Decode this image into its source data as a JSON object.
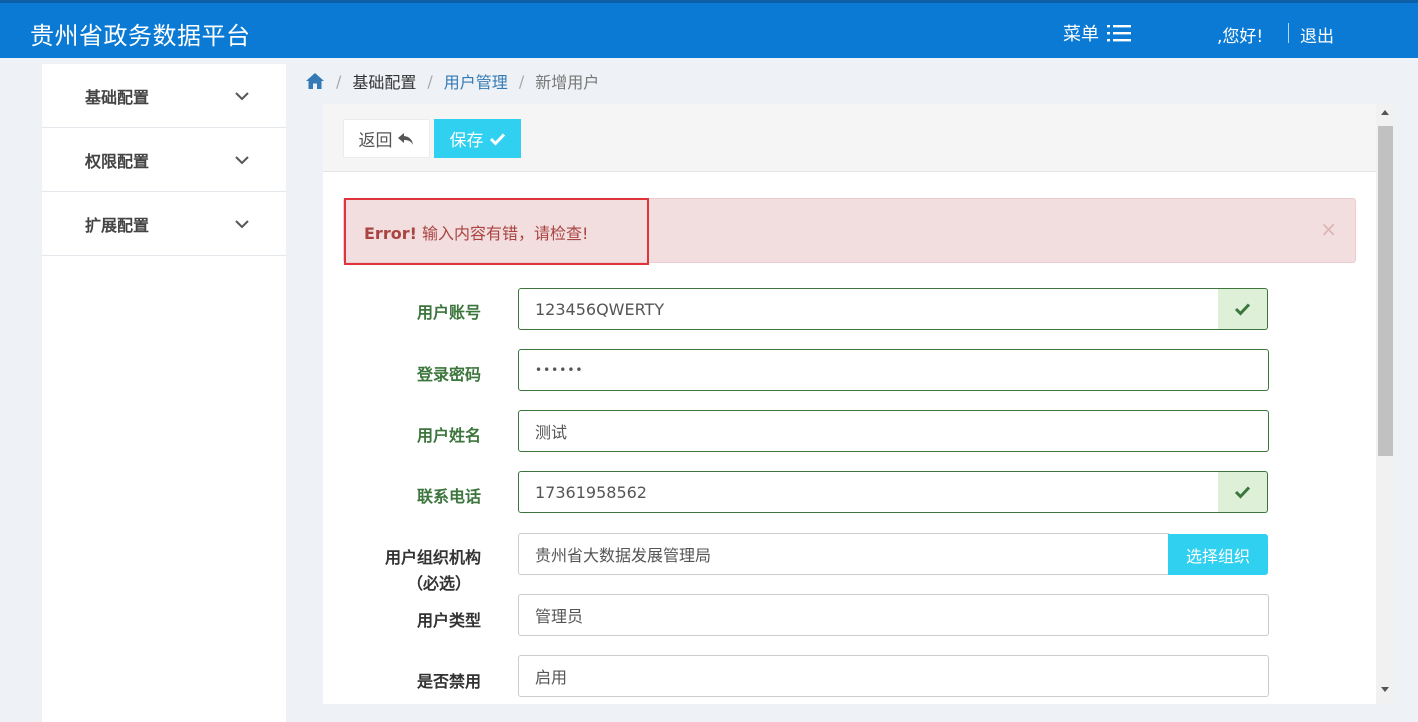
{
  "header": {
    "title": "贵州省政务数据平台",
    "menu_label": "菜单",
    "greeting": ",您好!",
    "logout": "退出"
  },
  "sidebar": {
    "items": [
      {
        "label": "基础配置"
      },
      {
        "label": "权限配置"
      },
      {
        "label": "扩展配置"
      }
    ]
  },
  "breadcrumb": {
    "home": "基础配置",
    "section": "用户管理",
    "current": "新增用户"
  },
  "toolbar": {
    "back_label": "返回",
    "save_label": "保存"
  },
  "alert": {
    "strong": "Error!",
    "message": " 输入内容有错，请检查!",
    "close": "×"
  },
  "form": {
    "account": {
      "label": "用户账号",
      "value": "123456QWERTY"
    },
    "password": {
      "label": "登录密码",
      "value": "••••••"
    },
    "name": {
      "label": "用户姓名",
      "value": "测试"
    },
    "phone": {
      "label": "联系电话",
      "value": "17361958562"
    },
    "org": {
      "label_line1": "用户组织机构",
      "label_line2": "（必选）",
      "value": "贵州省大数据发展管理局",
      "button": "选择组织"
    },
    "user_type": {
      "label": "用户类型",
      "value": "管理员"
    },
    "disabled": {
      "label": "是否禁用",
      "value": "启用"
    }
  },
  "colors": {
    "header_bg": "#0a7ad4",
    "accent_cyan": "#2fd0f0",
    "success_green": "#3c763d",
    "error_red": "#a94442",
    "highlight_red": "#e0343b"
  }
}
